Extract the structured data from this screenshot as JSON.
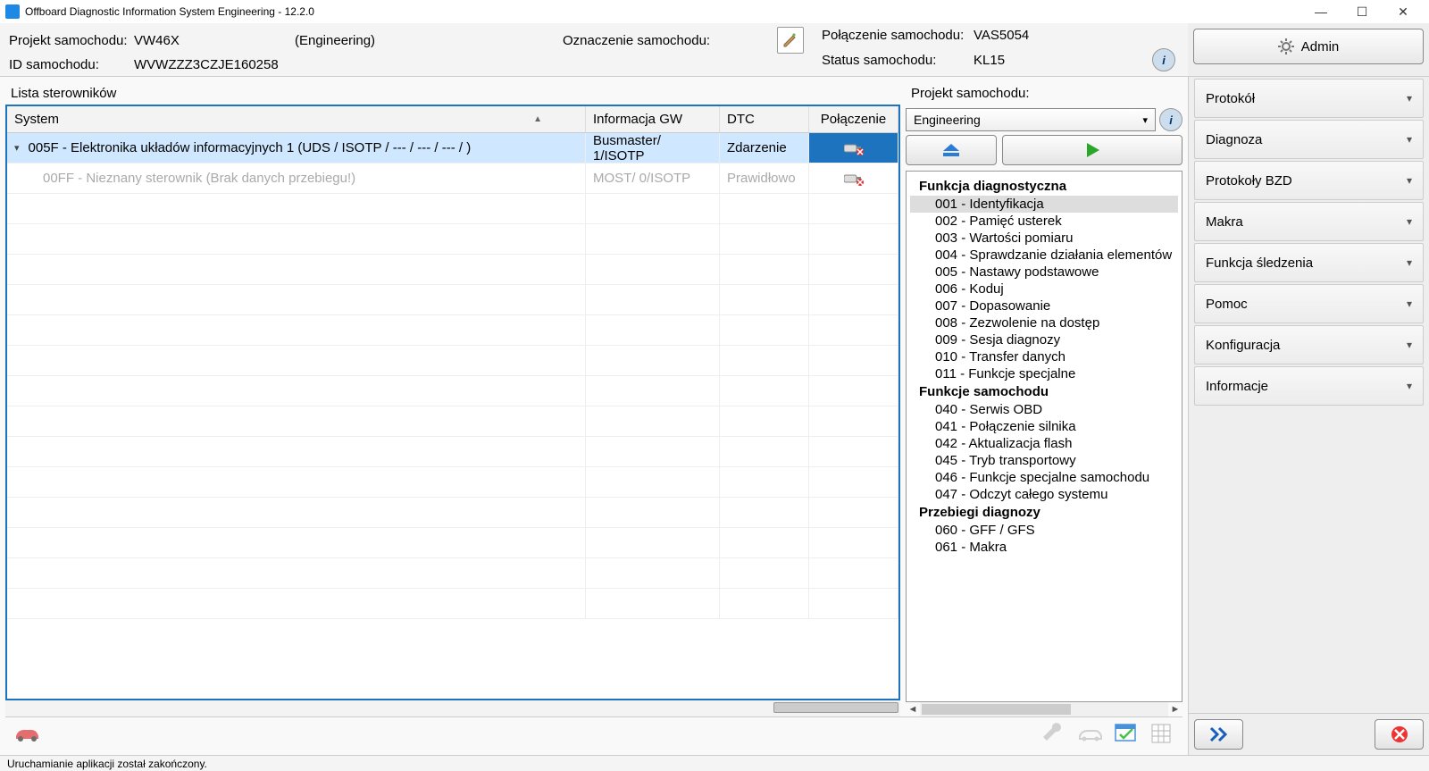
{
  "window": {
    "title": "Offboard Diagnostic Information System Engineering - 12.2.0"
  },
  "header": {
    "project_label": "Projekt samochodu:",
    "project_value": "VW46X",
    "project_mode": "(Engineering)",
    "designation_label": "Oznaczenie samochodu:",
    "id_label": "ID samochodu:",
    "id_value": "WVWZZZ3CZJE160258",
    "connection_label": "Połączenie samochodu:",
    "connection_value": "VAS5054",
    "status_label": "Status samochodu:",
    "status_value": "KL15"
  },
  "admin_button": "Admin",
  "side_menu": [
    "Protokół",
    "Diagnoza",
    "Protokoły BZD",
    "Makra",
    "Funkcja śledzenia",
    "Pomoc",
    "Konfiguracja",
    "Informacje"
  ],
  "left": {
    "title": "Lista sterowników",
    "columns": {
      "system": "System",
      "gw": "Informacja GW",
      "dtc": "DTC",
      "conn": "Połączenie"
    },
    "rows": [
      {
        "system": "005F - Elektronika układów informacyjnych 1  (UDS / ISOTP / --- / --- / --- /  )",
        "gw": "Busmaster/ 1/ISOTP",
        "dtc": "Zdarzenie",
        "selected": true,
        "expandable": true
      },
      {
        "system": "00FF - Nieznany sterownik  (Brak danych przebiegu!)",
        "gw": "MOST/ 0/ISOTP",
        "dtc": "Prawidłowo",
        "selected": false,
        "disabled": true,
        "indent": true
      }
    ]
  },
  "right": {
    "project_label": "Projekt samochodu:",
    "project_combo": "Engineering",
    "tree": [
      {
        "type": "header",
        "text": "Funkcja diagnostyczna"
      },
      {
        "type": "leaf",
        "text": "001 - Identyfikacja",
        "selected": true
      },
      {
        "type": "leaf",
        "text": "002 - Pamięć usterek"
      },
      {
        "type": "leaf",
        "text": "003 - Wartości pomiaru"
      },
      {
        "type": "leaf",
        "text": "004 - Sprawdzanie działania elementów"
      },
      {
        "type": "leaf",
        "text": "005 - Nastawy podstawowe"
      },
      {
        "type": "leaf",
        "text": "006 - Koduj"
      },
      {
        "type": "leaf",
        "text": "007 - Dopasowanie"
      },
      {
        "type": "leaf",
        "text": "008 - Zezwolenie na dostęp"
      },
      {
        "type": "leaf",
        "text": "009 - Sesja diagnozy"
      },
      {
        "type": "leaf",
        "text": "010 - Transfer danych"
      },
      {
        "type": "leaf",
        "text": "011 - Funkcje specjalne"
      },
      {
        "type": "header",
        "text": "Funkcje samochodu"
      },
      {
        "type": "leaf",
        "text": "040 - Serwis OBD"
      },
      {
        "type": "leaf",
        "text": "041 - Połączenie silnika"
      },
      {
        "type": "leaf",
        "text": "042 - Aktualizacja flash"
      },
      {
        "type": "leaf",
        "text": "045 - Tryb transportowy"
      },
      {
        "type": "leaf",
        "text": "046 - Funkcje specjalne samochodu"
      },
      {
        "type": "leaf",
        "text": "047 - Odczyt całego systemu"
      },
      {
        "type": "header",
        "text": "Przebiegi diagnozy"
      },
      {
        "type": "leaf",
        "text": "060 - GFF / GFS"
      },
      {
        "type": "leaf",
        "text": "061 - Makra"
      }
    ]
  },
  "status_bar": "Uruchamianie aplikacji został zakończony."
}
